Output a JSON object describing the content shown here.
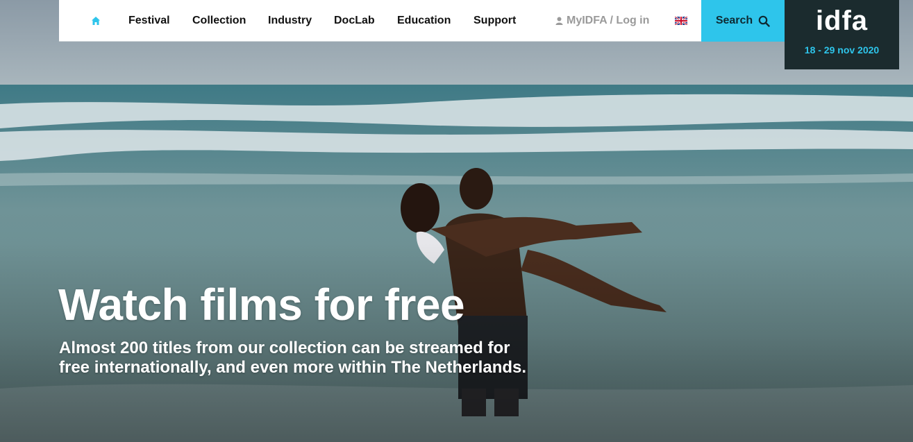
{
  "nav": {
    "home_icon": "home-icon",
    "items": [
      "Festival",
      "Collection",
      "Industry",
      "DocLab",
      "Education",
      "Support"
    ],
    "login_label": "MyIDFA / Log in",
    "user_icon": "user-icon",
    "language_flag": "uk-flag-icon",
    "search_label": "Search",
    "search_icon": "search-icon"
  },
  "brand": {
    "logo_text": "idfa",
    "dates": "18 - 29 nov 2020"
  },
  "hero": {
    "title": "Watch films for free",
    "subtitle": "Almost 200 titles from our collection can be streamed for free internationally, and even more within The Netherlands."
  },
  "colors": {
    "accent": "#2ec5eb",
    "logo_bg": "#1b2b2e",
    "nav_bg": "#ffffff"
  }
}
